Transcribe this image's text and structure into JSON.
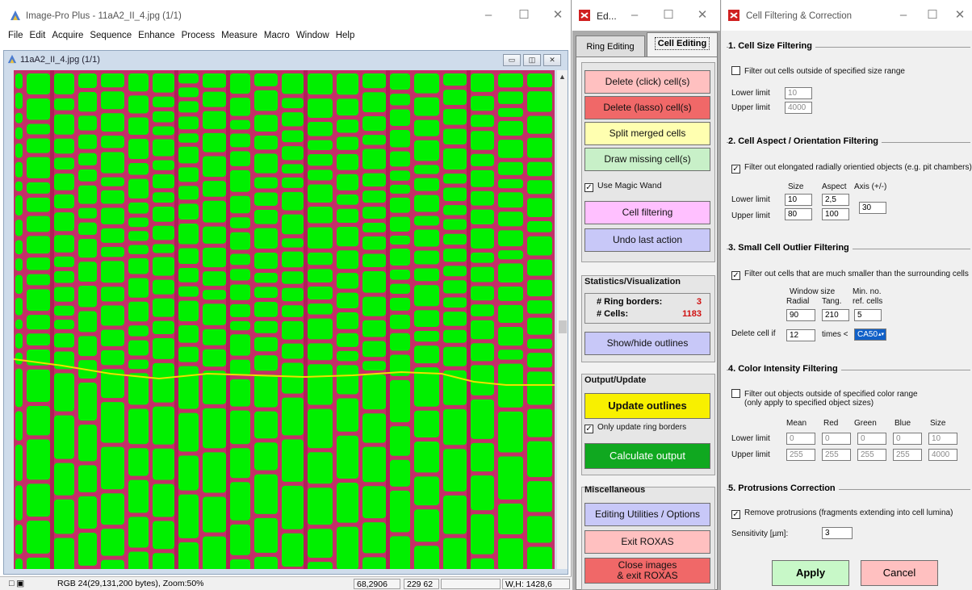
{
  "main_window": {
    "title": "Image-Pro Plus - 11aA2_II_4.jpg (1/1)",
    "menu": [
      "File",
      "Edit",
      "Acquire",
      "Sequence",
      "Enhance",
      "Process",
      "Measure",
      "Macro",
      "Window",
      "Help"
    ],
    "child_title": "11aA2_II_4.jpg (1/1)",
    "status": {
      "mode": "RGB 24(29,131,200 bytes), Zoom:50%",
      "value": "68,2906",
      "coords": "229  62",
      "wh": "W,H: 1428,6"
    },
    "colors": {
      "wall": "#c33068",
      "lumen": "#00f000",
      "ring_line": "#f0e000"
    }
  },
  "edit_window": {
    "title": "Ed...",
    "tabs": [
      "Ring Editing",
      "Cell Editing"
    ],
    "buttons": {
      "delete_click": "Delete (click) cell(s)",
      "delete_lasso": "Delete (lasso) cell(s)",
      "split": "Split merged cells",
      "draw_missing": "Draw missing cell(s)",
      "cell_filtering": "Cell filtering",
      "undo": "Undo last action",
      "show_hide": "Show/hide outlines",
      "update_outlines": "Update outlines",
      "calculate": "Calculate output",
      "utilities": "Editing Utilities / Options",
      "exit": "Exit ROXAS",
      "close_exit_1": "Close images",
      "close_exit_2": "& exit ROXAS"
    },
    "use_magic_wand": "Use Magic Wand",
    "stats_title": "Statistics/Visualization",
    "ring_borders_label": "# Ring borders:",
    "ring_borders_value": "3",
    "cells_label": "# Cells:",
    "cells_value": "1183",
    "output_title": "Output/Update",
    "only_update": "Only update ring borders",
    "misc_title": "Miscellaneous"
  },
  "cf_window": {
    "title": "Cell Filtering & Correction",
    "s1": {
      "title": "1. Cell Size Filtering",
      "check": "Filter out cells outside of specified size range",
      "lower_label": "Lower limit",
      "lower": "10",
      "upper_label": "Upper limit",
      "upper": "4000"
    },
    "s2": {
      "title": "2. Cell Aspect / Orientation Filtering",
      "check": "Filter out elongated radially orientied objects (e.g. pit chambers)",
      "h_size": "Size",
      "h_aspect": "Aspect",
      "h_axis": "Axis (+/-)",
      "lower_label": "Lower limit",
      "upper_label": "Upper limit",
      "size_lower": "10",
      "size_upper": "80",
      "aspect_lower": "2,5",
      "aspect_upper": "100",
      "axis": "30"
    },
    "s3": {
      "title": "3. Small Cell Outlier Filtering",
      "check": "Filter out cells that are much smaller than the surrounding cells",
      "h_window": "Window size",
      "h_minno": "Min. no.",
      "h_radial": "Radial",
      "h_tang": "Tang.",
      "h_ref": "ref. cells",
      "radial": "90",
      "tang": "210",
      "ref": "5",
      "delete_label": "Delete cell if",
      "factor": "12",
      "times": "times <",
      "ref_stat": "CA50"
    },
    "s4": {
      "title": "4. Color Intensity Filtering",
      "check1": "Filter out objects outside of specified color range",
      "check2": "(only apply to specified object sizes)",
      "headers": [
        "Mean",
        "Red",
        "Green",
        "Blue",
        "Size"
      ],
      "lower_label": "Lower limit",
      "upper_label": "Upper limit",
      "lower": [
        "0",
        "0",
        "0",
        "0",
        "10"
      ],
      "upper": [
        "255",
        "255",
        "255",
        "255",
        "4000"
      ]
    },
    "s5": {
      "title": "5. Protrusions Correction",
      "check": "Remove protrusions (fragments extending into cell lumina)",
      "sens_label": "Sensitivity [µm]:",
      "sens": "3"
    },
    "apply": "Apply",
    "cancel": "Cancel"
  }
}
